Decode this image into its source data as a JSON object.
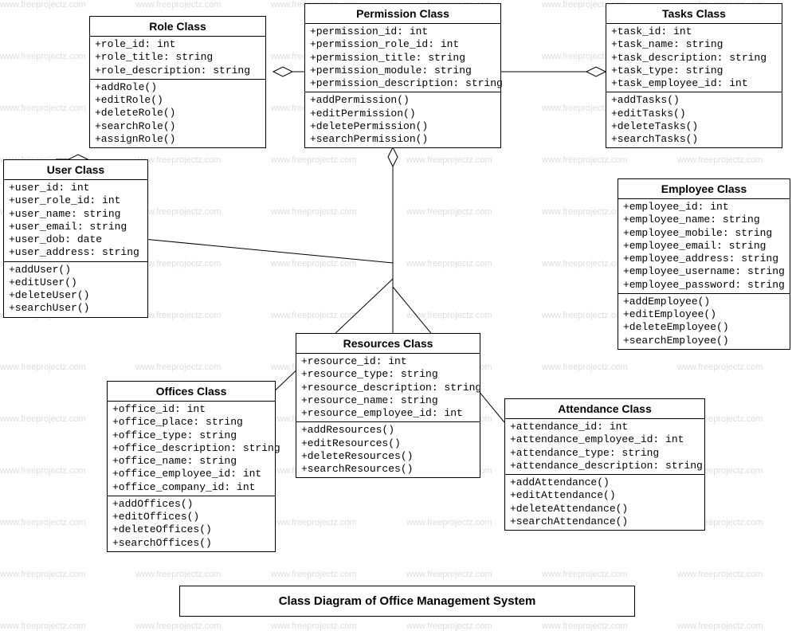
{
  "diagram_title": "Class Diagram of Office Management System",
  "watermark_text": "www.freeprojectz.com",
  "classes": {
    "role": {
      "title": "Role Class",
      "attributes": [
        "+role_id: int",
        "+role_title: string",
        "+role_description: string"
      ],
      "methods": [
        "+addRole()",
        "+editRole()",
        "+deleteRole()",
        "+searchRole()",
        "+assignRole()"
      ]
    },
    "permission": {
      "title": "Permission Class",
      "attributes": [
        "+permission_id: int",
        "+permission_role_id: int",
        "+permission_title: string",
        "+permission_module: string",
        "+permission_description: string"
      ],
      "methods": [
        "+addPermission()",
        "+editPermission()",
        "+deletePermission()",
        "+searchPermission()"
      ]
    },
    "tasks": {
      "title": "Tasks Class",
      "attributes": [
        "+task_id: int",
        "+task_name: string",
        "+task_description: string",
        "+task_type: string",
        "+task_employee_id: int"
      ],
      "methods": [
        "+addTasks()",
        "+editTasks()",
        "+deleteTasks()",
        "+searchTasks()"
      ]
    },
    "user": {
      "title": "User Class",
      "attributes": [
        "+user_id: int",
        "+user_role_id: int",
        "+user_name: string",
        "+user_email: string",
        "+user_dob: date",
        "+user_address: string"
      ],
      "methods": [
        "+addUser()",
        "+editUser()",
        "+deleteUser()",
        "+searchUser()"
      ]
    },
    "employee": {
      "title": "Employee Class",
      "attributes": [
        "+employee_id: int",
        "+employee_name: string",
        "+employee_mobile: string",
        "+employee_email: string",
        "+employee_address: string",
        "+employee_username: string",
        "+employee_password: string"
      ],
      "methods": [
        "+addEmployee()",
        "+editEmployee()",
        "+deleteEmployee()",
        "+searchEmployee()"
      ]
    },
    "resources": {
      "title": "Resources Class",
      "attributes": [
        "+resource_id: int",
        "+resource_type: string",
        "+resource_description: string",
        "+resource_name: string",
        "+resource_employee_id: int"
      ],
      "methods": [
        "+addResources()",
        "+editResources()",
        "+deleteResources()",
        "+searchResources()"
      ]
    },
    "offices": {
      "title": "Offices Class",
      "attributes": [
        "+office_id: int",
        "+office_place: string",
        "+office_type: string",
        "+office_description: string",
        "+office_name: string",
        "+office_employee_id: int",
        "+office_company_id: int"
      ],
      "methods": [
        "+addOffices()",
        "+editOffices()",
        "+deleteOffices()",
        "+searchOffices()"
      ]
    },
    "attendance": {
      "title": "Attendance Class",
      "attributes": [
        "+attendance_id: int",
        "+attendance_employee_id: int",
        "+attendance_type: string",
        "+attendance_description: string"
      ],
      "methods": [
        "+addAttendance()",
        "+editAttendance()",
        "+deleteAttendance()",
        "+searchAttendance()"
      ]
    }
  }
}
